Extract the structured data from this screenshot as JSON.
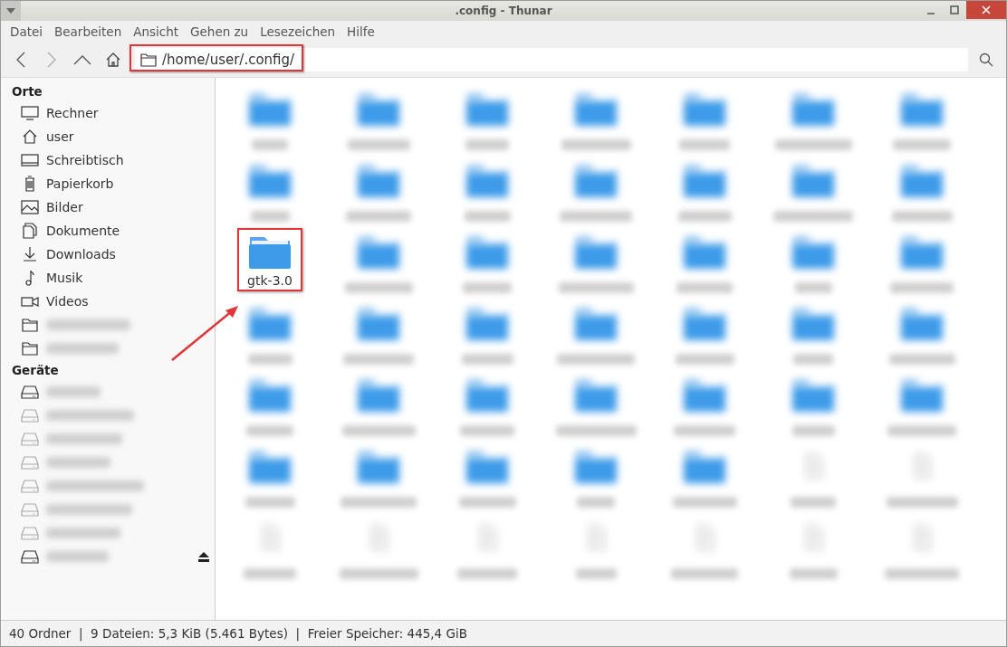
{
  "window": {
    "title": ".config - Thunar"
  },
  "menu": [
    "Datei",
    "Bearbeiten",
    "Ansicht",
    "Gehen zu",
    "Lesezeichen",
    "Hilfe"
  ],
  "toolbar": {
    "path": "/home/user/.config/",
    "path_highlighted": true
  },
  "sidebar": {
    "sections": [
      {
        "title": "Orte",
        "items": [
          {
            "kind": "place",
            "label": "Rechner"
          },
          {
            "kind": "place",
            "label": "user"
          },
          {
            "kind": "place",
            "label": "Schreibtisch"
          },
          {
            "kind": "place",
            "label": "Papierkorb"
          },
          {
            "kind": "place",
            "label": "Bilder"
          },
          {
            "kind": "place",
            "label": "Dokumente"
          },
          {
            "kind": "place",
            "label": "Downloads"
          },
          {
            "kind": "place",
            "label": "Musik"
          },
          {
            "kind": "place",
            "label": "Videos"
          },
          {
            "kind": "bookmark"
          },
          {
            "kind": "bookmark"
          }
        ]
      },
      {
        "title": "Geräte",
        "items": [
          {
            "kind": "drive",
            "dimmed": false,
            "eject": false
          },
          {
            "kind": "drive",
            "dimmed": true,
            "eject": false
          },
          {
            "kind": "drive",
            "dimmed": true,
            "eject": false
          },
          {
            "kind": "drive",
            "dimmed": true,
            "eject": false
          },
          {
            "kind": "drive",
            "dimmed": true,
            "eject": false
          },
          {
            "kind": "drive",
            "dimmed": true,
            "eject": false
          },
          {
            "kind": "drive",
            "dimmed": true,
            "eject": false
          },
          {
            "kind": "drive",
            "dimmed": false,
            "eject": true
          }
        ]
      }
    ]
  },
  "files": [
    {
      "kind": "folder"
    },
    {
      "kind": "folder"
    },
    {
      "kind": "folder"
    },
    {
      "kind": "folder"
    },
    {
      "kind": "folder"
    },
    {
      "kind": "folder"
    },
    {
      "kind": "folder"
    },
    {
      "kind": "folder"
    },
    {
      "kind": "folder"
    },
    {
      "kind": "folder"
    },
    {
      "kind": "folder"
    },
    {
      "kind": "folder"
    },
    {
      "kind": "folder"
    },
    {
      "kind": "folder"
    },
    {
      "kind": "folder",
      "name": "gtk-3.0",
      "highlighted": true
    },
    {
      "kind": "folder"
    },
    {
      "kind": "folder"
    },
    {
      "kind": "folder"
    },
    {
      "kind": "folder"
    },
    {
      "kind": "folder"
    },
    {
      "kind": "folder"
    },
    {
      "kind": "folder"
    },
    {
      "kind": "folder"
    },
    {
      "kind": "folder"
    },
    {
      "kind": "folder"
    },
    {
      "kind": "folder"
    },
    {
      "kind": "folder"
    },
    {
      "kind": "folder"
    },
    {
      "kind": "folder"
    },
    {
      "kind": "folder"
    },
    {
      "kind": "folder"
    },
    {
      "kind": "folder"
    },
    {
      "kind": "folder"
    },
    {
      "kind": "folder"
    },
    {
      "kind": "folder"
    },
    {
      "kind": "folder"
    },
    {
      "kind": "folder"
    },
    {
      "kind": "folder"
    },
    {
      "kind": "folder"
    },
    {
      "kind": "folder"
    },
    {
      "kind": "file"
    },
    {
      "kind": "file"
    },
    {
      "kind": "file"
    },
    {
      "kind": "file"
    },
    {
      "kind": "file"
    },
    {
      "kind": "file"
    },
    {
      "kind": "file"
    },
    {
      "kind": "file"
    },
    {
      "kind": "file"
    }
  ],
  "status_bar": "40 Ordner  |  9 Dateien: 5,3 KiB (5.461 Bytes)  |  Freier Speicher: 445,4 GiB"
}
